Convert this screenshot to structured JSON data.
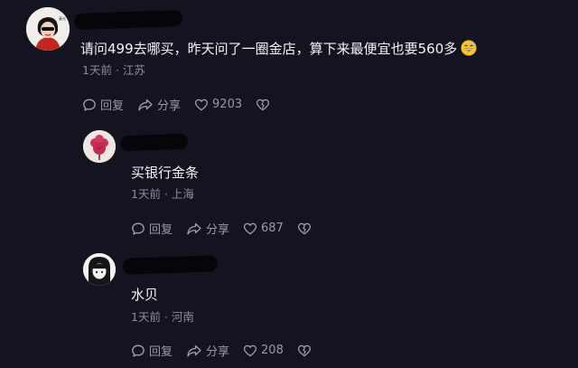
{
  "comments": [
    {
      "text": "请问499去哪买，昨天问了一圈金店，算下来最便宜也要560多",
      "emoji_icon": "beaming-sweat-emoji",
      "time": "1天前",
      "separator": "·",
      "location": "江苏",
      "reply_label": "回复",
      "share_label": "分享",
      "like_count": "9203"
    },
    {
      "text": "买银行金条",
      "time": "1天前",
      "separator": "·",
      "location": "上海",
      "reply_label": "回复",
      "share_label": "分享",
      "like_count": "687"
    },
    {
      "text": "水贝",
      "time": "1天前",
      "separator": "·",
      "location": "河南",
      "reply_label": "回复",
      "share_label": "分享",
      "like_count": "208"
    }
  ],
  "colors": {
    "background": "#141421",
    "text": "#f4f4f6",
    "meta_text": "#8d8d98",
    "action_text": "#9a9aa4",
    "redaction": "#05050a"
  }
}
